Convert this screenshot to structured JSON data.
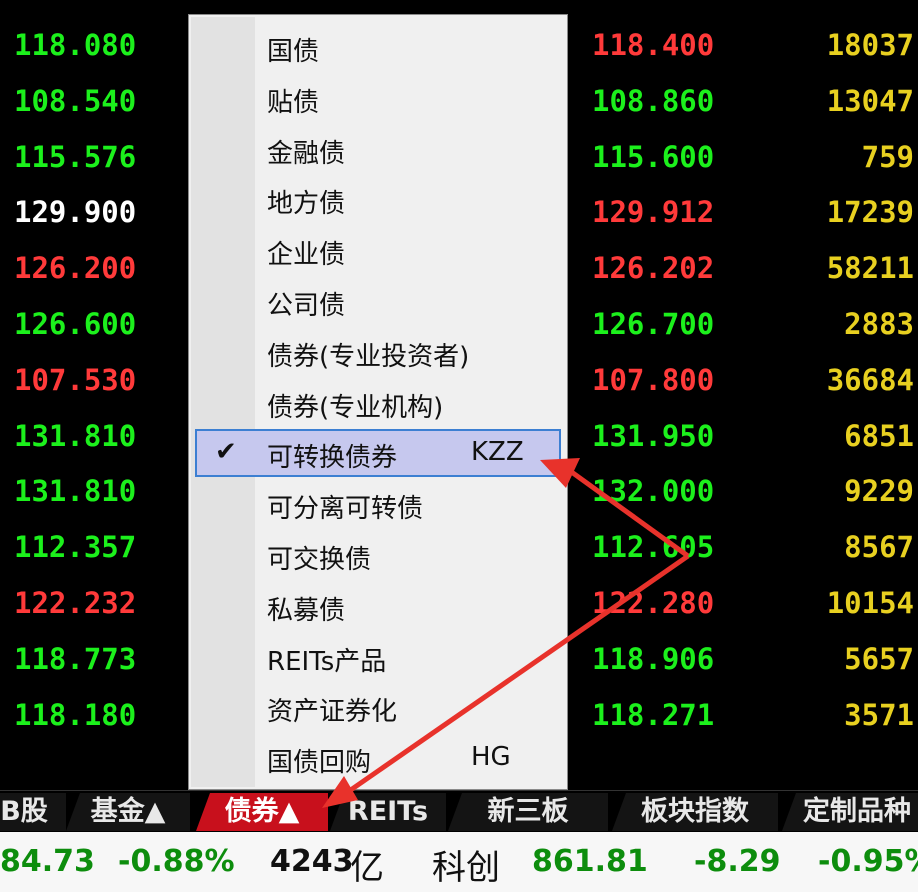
{
  "quotes": {
    "left": [
      {
        "v": "118.080",
        "c": "green"
      },
      {
        "v": "108.540",
        "c": "green"
      },
      {
        "v": "115.576",
        "c": "green"
      },
      {
        "v": "129.900",
        "c": "white"
      },
      {
        "v": "126.200",
        "c": "red"
      },
      {
        "v": "126.600",
        "c": "green"
      },
      {
        "v": "107.530",
        "c": "red"
      },
      {
        "v": "131.810",
        "c": "green"
      },
      {
        "v": "131.810",
        "c": "green"
      },
      {
        "v": "112.357",
        "c": "green"
      },
      {
        "v": "122.232",
        "c": "red"
      },
      {
        "v": "118.773",
        "c": "green"
      },
      {
        "v": "118.180",
        "c": "green"
      }
    ],
    "mid": [
      {
        "v": "118.400",
        "c": "red"
      },
      {
        "v": "108.860",
        "c": "green"
      },
      {
        "v": "115.600",
        "c": "green"
      },
      {
        "v": "129.912",
        "c": "red"
      },
      {
        "v": "126.202",
        "c": "red"
      },
      {
        "v": "126.700",
        "c": "green"
      },
      {
        "v": "107.800",
        "c": "red"
      },
      {
        "v": "131.950",
        "c": "green"
      },
      {
        "v": "132.000",
        "c": "green"
      },
      {
        "v": "112.605",
        "c": "green"
      },
      {
        "v": "122.280",
        "c": "red"
      },
      {
        "v": "118.906",
        "c": "green"
      },
      {
        "v": "118.271",
        "c": "green"
      }
    ],
    "right": [
      "18037",
      "13047",
      "759",
      "17239",
      "58211",
      "2883",
      "36684",
      "6851",
      "9229",
      "8567",
      "10154",
      "5657",
      "3571"
    ]
  },
  "menu": {
    "items": [
      {
        "label": "国债",
        "shortcut": ""
      },
      {
        "label": "贴债",
        "shortcut": ""
      },
      {
        "label": "金融债",
        "shortcut": ""
      },
      {
        "label": "地方债",
        "shortcut": ""
      },
      {
        "label": "企业债",
        "shortcut": ""
      },
      {
        "label": "公司债",
        "shortcut": ""
      },
      {
        "label": "债券(专业投资者)",
        "shortcut": ""
      },
      {
        "label": "债券(专业机构)",
        "shortcut": ""
      },
      {
        "label": "可转换债券",
        "shortcut": "KZZ",
        "checked": true
      },
      {
        "label": "可分离可转债",
        "shortcut": ""
      },
      {
        "label": "可交换债",
        "shortcut": ""
      },
      {
        "label": "私募债",
        "shortcut": ""
      },
      {
        "label": "REITs产品",
        "shortcut": ""
      },
      {
        "label": "资产证券化",
        "shortcut": ""
      },
      {
        "label": "国债回购",
        "shortcut": "HG"
      }
    ],
    "check_glyph": "✔"
  },
  "tabs": [
    {
      "label": "B股"
    },
    {
      "label": "基金▲"
    },
    {
      "label": "债券▲",
      "active": true
    },
    {
      "label": "REITs"
    },
    {
      "label": "新三板"
    },
    {
      "label": "板块指数"
    },
    {
      "label": "定制品种"
    }
  ],
  "ticker": {
    "value1": "84.73",
    "pct1": "-0.88%",
    "amount": "4243",
    "amount_unit": "亿",
    "index_name": "科创",
    "value2": "861.81",
    "change2": "-8.29",
    "pct2": "-0.95%"
  },
  "colors": {
    "arrow": "#e8322b",
    "up": "#ff3a3a",
    "down": "#1cf01c",
    "volume": "#e8d020"
  }
}
